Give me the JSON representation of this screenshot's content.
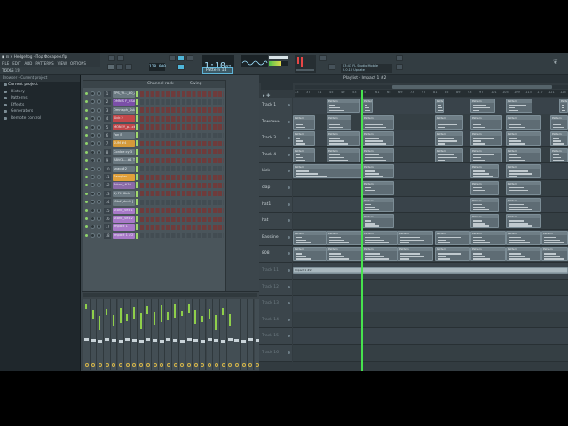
{
  "title": "Hedgehog - Под Фонарем.flp",
  "menu": [
    "FILE",
    "EDIT",
    "ADD",
    "PATTERNS",
    "VIEW",
    "OPTIONS",
    "TOOLS",
    "?"
  ],
  "clock": {
    "time": "1:10",
    "sub": "07",
    "tempo": "128.000"
  },
  "pattern_selector": "Pattern 14",
  "hint_panel": {
    "line1": "03:43  FL Studio Mobile",
    "line2": "2.0.10 Update"
  },
  "browser": {
    "header": "Browser - Current project",
    "counter": "47  65  15",
    "items": [
      "Current project",
      "History",
      "Patterns",
      "Effects",
      "Generators",
      "Remote control"
    ]
  },
  "channel_rack": {
    "title": "Channel rack",
    "swing": "Swing",
    "channels": [
      {
        "num": "1",
        "name": "TPS_W..._A0_A",
        "color": "#6a7880"
      },
      {
        "num": "2",
        "name": "OMNIS F_CSAXS",
        "color": "#7b4fa8"
      },
      {
        "num": "3",
        "name": "Omnisph_SulaA2",
        "color": "#6a7880"
      },
      {
        "num": "4",
        "name": "Kick 2",
        "color": "#c2484a"
      },
      {
        "num": "5",
        "name": "MONEY_p...ck2",
        "color": "#c2484a"
      },
      {
        "num": "6",
        "name": "Fan B",
        "color": "#6a7880"
      },
      {
        "num": "7",
        "name": "SUM #4",
        "color": "#d59a3a"
      },
      {
        "num": "8",
        "name": "Conlee cy 3",
        "color": "#6a7880"
      },
      {
        "num": "9",
        "name": "ABVOL...#1 TL1",
        "color": "#6a7880"
      },
      {
        "num": "10",
        "name": "snap #2",
        "color": "#6a7880"
      },
      {
        "num": "11",
        "name": "Sampler",
        "color": "#e0a03a"
      },
      {
        "num": "12",
        "name": "fbhnd_#10",
        "color": "#8a6aa8"
      },
      {
        "num": "13",
        "name": "1) FH Kick",
        "color": "#6a7880"
      },
      {
        "num": "14",
        "name": "[8b#_dnd+]",
        "color": "#6a7880"
      },
      {
        "num": "15",
        "name": "Stone_ve#1",
        "color": "#a879c8"
      },
      {
        "num": "16",
        "name": "Stone_ve#2",
        "color": "#a879c8"
      },
      {
        "num": "17",
        "name": "Impact 1",
        "color": "#a879c8"
      },
      {
        "num": "18",
        "name": "Impact 1 #2",
        "color": "#a879c8"
      }
    ]
  },
  "playlist": {
    "title": "Playlist - Impact 1 #2",
    "ruler": [
      "33",
      "37",
      "41",
      "45",
      "49",
      "53",
      "57",
      "61",
      "65",
      "69",
      "73",
      "77",
      "81",
      "85",
      "89",
      "93",
      "97",
      "101",
      "105",
      "109",
      "113",
      "117",
      "121",
      "125"
    ],
    "tracks": [
      "Track 1",
      "Томлины",
      "Track 3",
      "Track 4",
      "kick",
      "clap",
      "hat1",
      "hat",
      "Bassline",
      "808",
      "Track 11",
      "Track 12",
      "Track 13",
      "Track 14",
      "Track 15",
      "Track 16"
    ],
    "clip_label": "Pattern",
    "audio_clip_label": "Impact 1 #2"
  }
}
